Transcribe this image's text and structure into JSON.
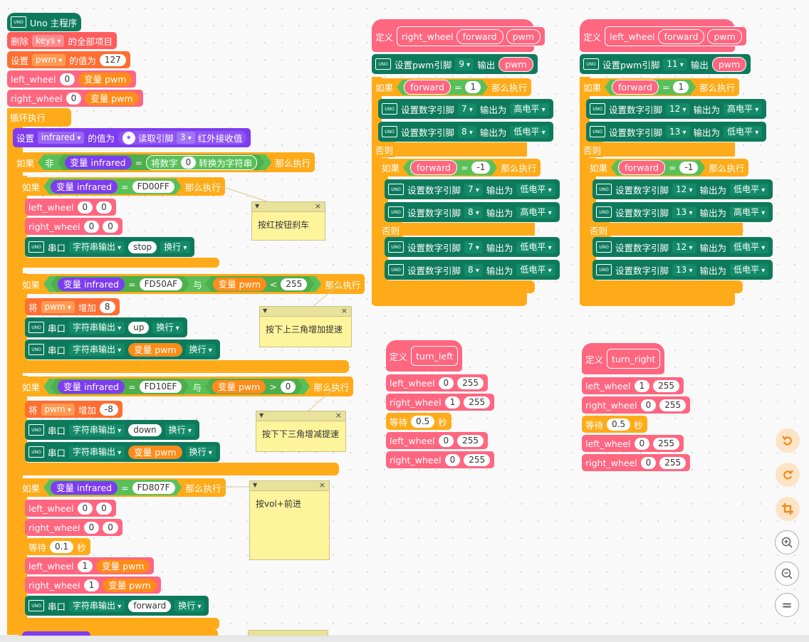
{
  "main": {
    "hat": "Uno 主程序",
    "uno_icon": "UNO",
    "delete_items": {
      "prefix": "删除",
      "list": "keys",
      "suffix": "的全部项目"
    },
    "set_pwm": {
      "prefix": "设置",
      "var": "pwm",
      "mid": "的值为",
      "value": "127"
    },
    "left_wheel_init": {
      "name": "left_wheel",
      "a": "0",
      "b": "变量 pwm"
    },
    "right_wheel_init": {
      "name": "right_wheel",
      "a": "0",
      "b": "变量 pwm"
    },
    "loop": "循环执行",
    "set_infrared": {
      "prefix": "设置",
      "var": "infrared",
      "mid": "的值为",
      "read": "读取引脚",
      "pin": "3",
      "suffix": "红外接收值"
    },
    "if_not": {
      "if": "如果",
      "not": "非",
      "var": "变量 infrared",
      "eq": "=",
      "conv": "将数字",
      "num": "0",
      "conv2": "转换为字符串",
      "then": "那么执行"
    },
    "if1": {
      "if": "如果",
      "var": "变量 infrared",
      "eq": "=",
      "code": "FD00FF",
      "then": "那么执行",
      "left": {
        "name": "left_wheel",
        "a": "0",
        "b": "0"
      },
      "right": {
        "name": "right_wheel",
        "a": "0",
        "b": "0"
      },
      "serial": {
        "port": "串口",
        "mode": "字符串输出",
        "text": "stop",
        "nl": "换行"
      }
    },
    "if2": {
      "if": "如果",
      "var": "变量 infrared",
      "eq": "=",
      "code": "FD50AF",
      "and": "与",
      "var2": "变量 pwm",
      "op": "<",
      "num": "255",
      "then": "那么执行",
      "change": {
        "prefix": "将",
        "var": "pwm",
        "mid": "增加",
        "value": "8"
      },
      "serial1": {
        "port": "串口",
        "mode": "字符串输出",
        "text": "up",
        "nl": "换行"
      },
      "serial2": {
        "port": "串口",
        "mode": "字符串输出",
        "text": "变量 pwm",
        "nl": "换行"
      }
    },
    "if3": {
      "if": "如果",
      "var": "变量 infrared",
      "eq": "=",
      "code": "FD10EF",
      "and": "与",
      "var2": "变量 pwm",
      "op": ">",
      "num": "0",
      "then": "那么执行",
      "change": {
        "prefix": "将",
        "var": "pwm",
        "mid": "增加",
        "value": "-8"
      },
      "serial1": {
        "port": "串口",
        "mode": "字符串输出",
        "text": "down",
        "nl": "换行"
      },
      "serial2": {
        "port": "串口",
        "mode": "字符串输出",
        "text": "变量 pwm",
        "nl": "换行"
      }
    },
    "if4": {
      "if": "如果",
      "var": "变量 infrared",
      "eq": "=",
      "code": "FD807F",
      "then": "那么执行",
      "left": {
        "name": "left_wheel",
        "a": "0",
        "b": "0"
      },
      "right": {
        "name": "right_wheel",
        "a": "0",
        "b": "0"
      },
      "wait": {
        "prefix": "等待",
        "value": "0.1",
        "unit": "秒"
      },
      "left2": {
        "name": "left_wheel",
        "a": "1",
        "b": "变量 pwm"
      },
      "right2": {
        "name": "right_wheel",
        "a": "1",
        "b": "变量 pwm"
      },
      "serial": {
        "port": "串口",
        "mode": "字符串输出",
        "text": "forward",
        "nl": "换行"
      }
    }
  },
  "notes": {
    "n1": "按红按钮刹车",
    "n2": "按下上三角增加提速",
    "n3": "按下下三角增减提速",
    "n4": "按vol+前进"
  },
  "right_wheel_def": {
    "define": "定义",
    "name": "right_wheel",
    "p1": "forward",
    "p2": "pwm",
    "pwm_set": {
      "label": "设置pwm引脚",
      "pin": "9",
      "out": "输出",
      "var": "pwm"
    },
    "if": "如果",
    "cond_var": "forward",
    "eq": "=",
    "cond_val": "1",
    "then": "那么执行",
    "d1": {
      "label": "设置数字引脚",
      "pin": "7",
      "out": "输出为",
      "level": "高电平"
    },
    "d2": {
      "label": "设置数字引脚",
      "pin": "8",
      "out": "输出为",
      "level": "低电平"
    },
    "else": "否则",
    "if_b": "如果",
    "cond_b_var": "forward",
    "cond_b_val": "-1",
    "then_b": "那么执行",
    "d3": {
      "label": "设置数字引脚",
      "pin": "7",
      "out": "输出为",
      "level": "低电平"
    },
    "d4": {
      "label": "设置数字引脚",
      "pin": "8",
      "out": "输出为",
      "level": "高电平"
    },
    "else_b": "否则",
    "d5": {
      "label": "设置数字引脚",
      "pin": "7",
      "out": "输出为",
      "level": "低电平"
    },
    "d6": {
      "label": "设置数字引脚",
      "pin": "8",
      "out": "输出为",
      "level": "低电平"
    }
  },
  "left_wheel_def": {
    "define": "定义",
    "name": "left_wheel",
    "p1": "forward",
    "p2": "pwm",
    "pwm_set": {
      "label": "设置pwm引脚",
      "pin": "11",
      "out": "输出",
      "var": "pwm"
    },
    "if": "如果",
    "cond_var": "forward",
    "eq": "=",
    "cond_val": "1",
    "then": "那么执行",
    "d1": {
      "label": "设置数字引脚",
      "pin": "12",
      "out": "输出为",
      "level": "高电平"
    },
    "d2": {
      "label": "设置数字引脚",
      "pin": "13",
      "out": "输出为",
      "level": "低电平"
    },
    "else": "否则",
    "if_b": "如果",
    "cond_b_var": "forward",
    "cond_b_val": "-1",
    "then_b": "那么执行",
    "d3": {
      "label": "设置数字引脚",
      "pin": "12",
      "out": "输出为",
      "level": "低电平"
    },
    "d4": {
      "label": "设置数字引脚",
      "pin": "13",
      "out": "输出为",
      "level": "高电平"
    },
    "else_b": "否则",
    "d5": {
      "label": "设置数字引脚",
      "pin": "12",
      "out": "输出为",
      "level": "低电平"
    },
    "d6": {
      "label": "设置数字引脚",
      "pin": "13",
      "out": "输出为",
      "level": "低电平"
    }
  },
  "turn_left": {
    "define": "定义",
    "name": "turn_left",
    "l1": {
      "name": "left_wheel",
      "a": "0",
      "b": "255"
    },
    "r1": {
      "name": "right_wheel",
      "a": "1",
      "b": "255"
    },
    "wait": {
      "prefix": "等待",
      "value": "0.5",
      "unit": "秒"
    },
    "l2": {
      "name": "left_wheel",
      "a": "0",
      "b": "255"
    },
    "r2": {
      "name": "right_wheel",
      "a": "0",
      "b": "255"
    }
  },
  "turn_right": {
    "define": "定义",
    "name": "turn_right",
    "l1": {
      "name": "left_wheel",
      "a": "1",
      "b": "255"
    },
    "r1": {
      "name": "right_wheel",
      "a": "0",
      "b": "255"
    },
    "wait": {
      "prefix": "等待",
      "value": "0.5",
      "unit": "秒"
    },
    "l2": {
      "name": "left_wheel",
      "a": "0",
      "b": "255"
    },
    "r2": {
      "name": "right_wheel",
      "a": "0",
      "b": "255"
    }
  },
  "controls": {
    "undo": "undo-icon",
    "redo": "redo-icon",
    "crop": "crop-icon",
    "zoom_in": "zoom-in-icon",
    "zoom_out": "zoom-out-icon",
    "reset": "="
  }
}
